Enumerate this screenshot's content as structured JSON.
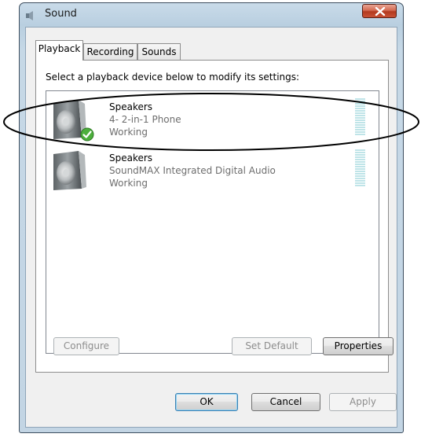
{
  "window": {
    "title": "Sound",
    "close_icon": "close-icon"
  },
  "tabs": [
    {
      "label": "Playback",
      "active": true
    },
    {
      "label": "Recording",
      "active": false
    },
    {
      "label": "Sounds",
      "active": false
    }
  ],
  "panel": {
    "instruction": "Select a playback device below to modify its settings:"
  },
  "devices": [
    {
      "name": "Speakers",
      "description": "4- 2-in-1 Phone",
      "status": "Working",
      "icon": "speaker-icon",
      "default_badge_icon": "check-badge-icon",
      "is_default": true
    },
    {
      "name": "Speakers",
      "description": "SoundMAX Integrated Digital Audio",
      "status": "Working",
      "icon": "speaker-icon",
      "is_default": false
    }
  ],
  "buttons": {
    "configure": "Configure",
    "set_default": "Set Default",
    "properties": "Properties",
    "ok": "OK",
    "cancel": "Cancel",
    "apply": "Apply"
  },
  "colors": {
    "level_meter": "#bfe4e8",
    "default_badge": "#4caf3c",
    "close_button": "#c95236"
  }
}
